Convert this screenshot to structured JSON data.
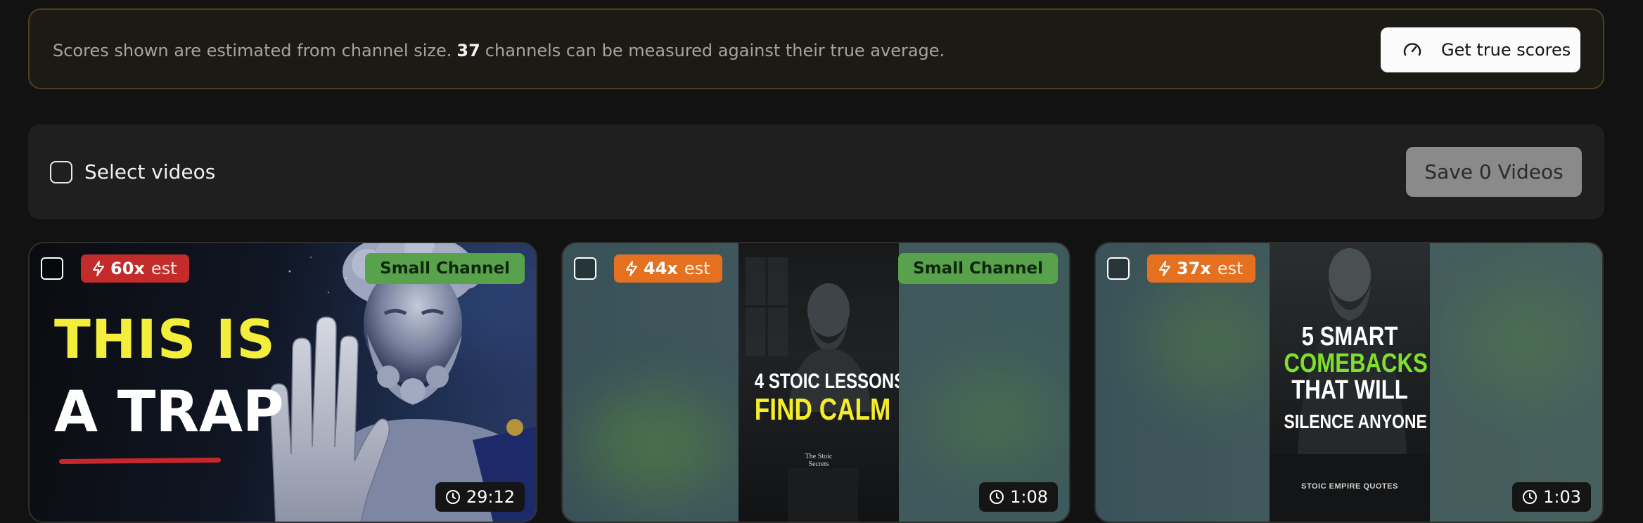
{
  "banner": {
    "text_before": "Scores shown are estimated from channel size.",
    "channel_count": "37",
    "text_after": "channels can be measured against their true average.",
    "button_label": "Get true scores",
    "button_icon": "gauge-icon"
  },
  "toolbar": {
    "select_label": "Select videos",
    "save_label": "Save 0 Videos"
  },
  "colors": {
    "background": "#121212",
    "banner_border": "#4e3f1c",
    "score_red": "#c42b2b",
    "score_orange": "#e5701f",
    "small_channel_green": "#57a24a",
    "save_button_disabled": "#8a8a8a"
  },
  "videos": [
    {
      "score_multiplier": "60x",
      "score_suffix": "est",
      "score_icon": "lightning-icon",
      "channel_badge": "Small Channel",
      "duration": "29:12",
      "thumbnail_text": [
        "THIS IS",
        "A TRAP"
      ]
    },
    {
      "score_multiplier": "44x",
      "score_suffix": "est",
      "score_icon": "lightning-icon",
      "channel_badge": "Small Channel",
      "duration": "1:08",
      "thumbnail_text": [
        "4 STOIC LESSONS",
        "FIND CALM",
        "The Stoic",
        "Secrets"
      ]
    },
    {
      "score_multiplier": "37x",
      "score_suffix": "est",
      "score_icon": "lightning-icon",
      "duration": "1:03",
      "thumbnail_text": [
        "5 SMART",
        "COMEBACKS",
        "THAT WILL",
        "SILENCE ANYONE",
        "STOIC EMPIRE QUOTES"
      ]
    }
  ]
}
